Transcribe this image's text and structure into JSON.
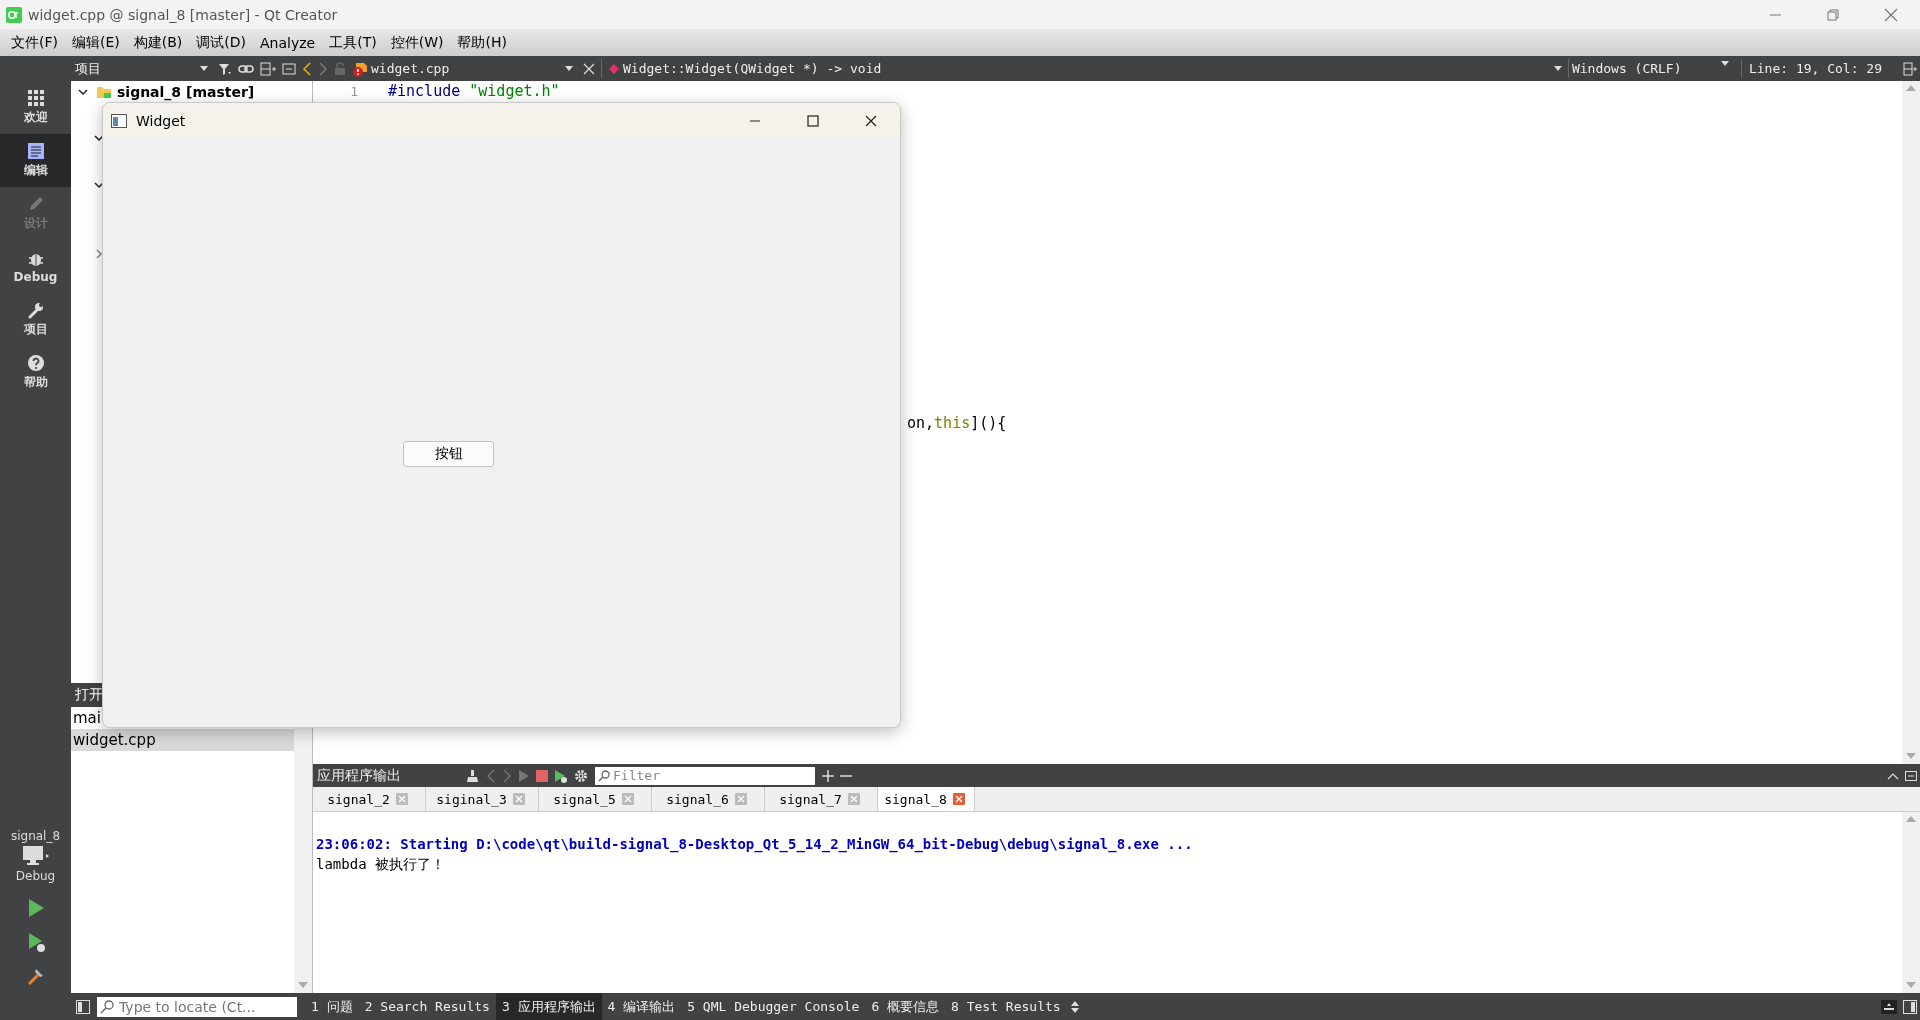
{
  "window": {
    "title": "widget.cpp @ signal_8 [master] - Qt Creator"
  },
  "menu": [
    "文件(F)",
    "编辑(E)",
    "构建(B)",
    "调试(D)",
    "Analyze",
    "工具(T)",
    "控件(W)",
    "帮助(H)"
  ],
  "modes": [
    {
      "label": "欢迎",
      "selected": false,
      "disabled": false
    },
    {
      "label": "编辑",
      "selected": true,
      "disabled": false
    },
    {
      "label": "设计",
      "selected": false,
      "disabled": true
    },
    {
      "label": "Debug",
      "selected": false,
      "disabled": false
    },
    {
      "label": "项目",
      "selected": false,
      "disabled": false
    },
    {
      "label": "帮助",
      "selected": false,
      "disabled": false
    }
  ],
  "kit": {
    "project": "signal_8",
    "config": "Debug"
  },
  "project_pane": {
    "view": "项目",
    "tree": [
      {
        "label": "signal_8 [master]",
        "expanded": true,
        "children": [
          {
            "expanded": true
          },
          {
            "expanded": true
          },
          {
            "expanded": false
          }
        ]
      }
    ]
  },
  "open_documents": {
    "header": "打开",
    "items": [
      {
        "label": "mai",
        "selected": false
      },
      {
        "label": "widget.cpp",
        "selected": true
      }
    ]
  },
  "editor": {
    "file": "widget.cpp",
    "symbol": "Widget::Widget(QWidget *) -> void",
    "line_ending": "Windows (CRLF)",
    "position": "Line: 19, Col: 29",
    "lines": [
      {
        "kind": "line",
        "number": "1",
        "tokens": [
          {
            "kind": "preprocessor",
            "text": "#include "
          },
          {
            "kind": "string",
            "text": "\"widget.h\""
          }
        ]
      },
      {
        "kind": "fragment",
        "tokens": [
          {
            "kind": "plain",
            "text": "on,"
          },
          {
            "kind": "keyword",
            "text": "this"
          },
          {
            "kind": "plain",
            "text": "](){"
          }
        ]
      }
    ]
  },
  "output": {
    "title": "应用程序输出",
    "filter_placeholder": "Filter",
    "tabs": [
      {
        "label": "signal_2",
        "selected": false
      },
      {
        "label": "siginal_3",
        "selected": false
      },
      {
        "label": "signal_5",
        "selected": false
      },
      {
        "label": "signal_6",
        "selected": false
      },
      {
        "label": "signal_7",
        "selected": false
      },
      {
        "label": "signal_8",
        "selected": true
      }
    ],
    "lines": [
      {
        "kind": "status",
        "text": "23:06:02: Starting D:\\code\\qt\\build-signal_8-Desktop_Qt_5_14_2_MinGW_64_bit-Debug\\debug\\signal_8.exe ..."
      },
      {
        "kind": "stdout",
        "text": "lambda 被执行了！"
      }
    ]
  },
  "status_bar": {
    "locate_placeholder": "Type to locate (Ct...",
    "panes": [
      {
        "label": "1 问题",
        "selected": false
      },
      {
        "label": "2 Search Results",
        "selected": false
      },
      {
        "label": "3 应用程序输出",
        "selected": true
      },
      {
        "label": "4 编译输出",
        "selected": false
      },
      {
        "label": "5 QML Debugger Console",
        "selected": false
      },
      {
        "label": "6 概要信息",
        "selected": false
      },
      {
        "label": "8 Test Results",
        "selected": false
      }
    ]
  },
  "app_window": {
    "title": "Widget",
    "button": "按钮"
  }
}
